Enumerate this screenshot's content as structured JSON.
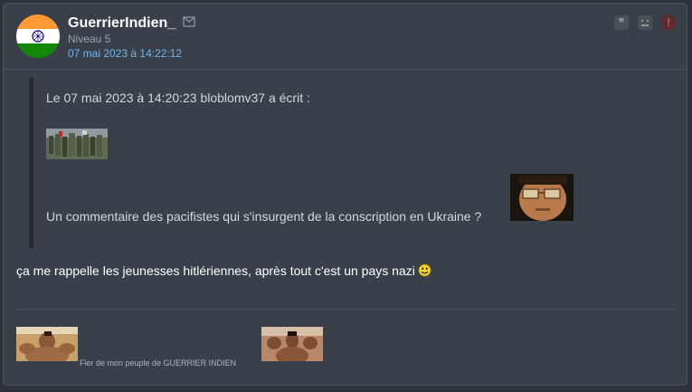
{
  "post": {
    "username": "GuerrierIndien_",
    "level": "Niveau 5",
    "date": "07 mai 2023 à 14:22:12",
    "avatar_icon": "india-flag-icon",
    "actions": {
      "quote_icon": "quote-icon",
      "quote_glyph": "❞",
      "dislike_icon": "sad-face-icon",
      "report_icon": "report-icon",
      "report_glyph": "!"
    },
    "quote": {
      "header": "Le 07 mai 2023 à 14:20:23 bloblomv37 a écrit :",
      "image": "soldiers-photo",
      "text": "Un commentaire des pacifistes qui s'insurgent de la conscription en Ukraine ?",
      "sticker": "man-glasses-sticker"
    },
    "message": "ça me rappelle les jeunesses hitlériennes, après tout c'est un pays nazi",
    "message_emoji": "smiley-icon",
    "signature": {
      "text": "Fier de mon peuple de GUERRIER INDIEN",
      "image1": "muscle-man-photo",
      "image2": "bodybuilder-photo"
    },
    "colors": {
      "background": "#394049",
      "date_link": "#6fb6f0",
      "report": "#d45757"
    }
  }
}
